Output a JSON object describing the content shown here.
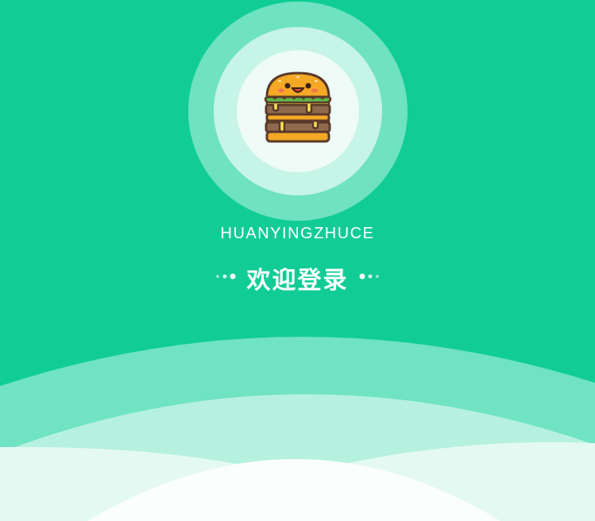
{
  "app": {
    "name": "HUANYINGZHUCE",
    "welcome": "欢迎登录"
  },
  "icons": {
    "logo": "burger-icon",
    "decoration": "dots-icon"
  },
  "colors": {
    "primary": "#11cd95",
    "ring_outer": "#6fe2c0",
    "ring_middle": "#c6f4e6",
    "ring_inner": "#eefbf6",
    "text": "#ffffff"
  }
}
